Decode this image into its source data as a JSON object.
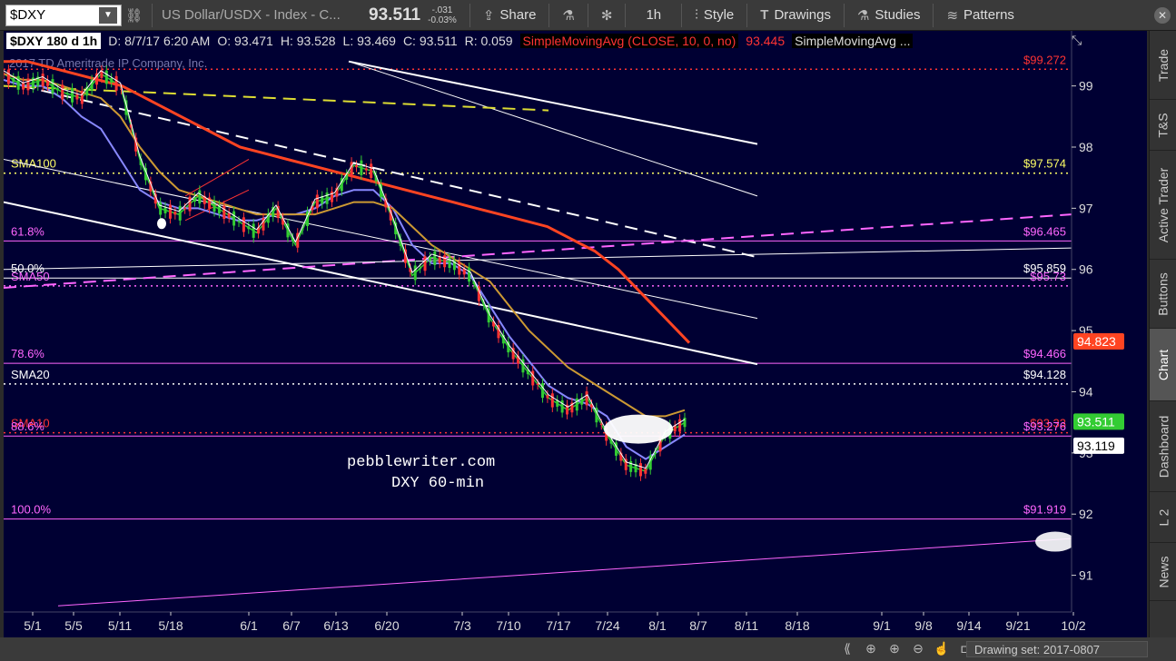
{
  "toolbar": {
    "symbol": "$DXY",
    "description": "US Dollar/USDX - Index - C...",
    "price": "93.511",
    "change_abs": "-.031",
    "change_pct": "-0.03%",
    "share_label": "Share",
    "interval_label": "1h",
    "style_label": "Style",
    "drawings_label": "Drawings",
    "studies_label": "Studies",
    "patterns_label": "Patterns"
  },
  "infobar": {
    "symbol": "$DXY 180 d 1h",
    "date": "D: 8/7/17 6:20 AM",
    "open": "O: 93.471",
    "high": "H: 93.528",
    "low": "L: 93.469",
    "close": "C: 93.511",
    "range": "R: 0.059",
    "sma10_label": "SimpleMovingAvg (CLOSE, 10, 0, no)",
    "sma10_value": "93.445",
    "sma_more": "SimpleMovingAvg ..."
  },
  "watermark": "2017 TD Ameritrade IP Company, Inc.",
  "annotation": {
    "line1": "pebblewriter.com",
    "line2": "DXY 60-min"
  },
  "level_labels": [
    {
      "name": "SMA100",
      "left": "SMA100",
      "right": "$97.574",
      "price": 97.574,
      "color": "#ffff66",
      "style": "dotted"
    },
    {
      "name": "fib-61",
      "left": "61.8%",
      "right": "$96.465",
      "price": 96.465,
      "color": "#ff66ff",
      "style": "solid"
    },
    {
      "name": "fib-50",
      "left": "50.0%",
      "right": "$95.859",
      "price": 95.859,
      "color": "#ffffff",
      "style": "solid"
    },
    {
      "name": "SMA50",
      "left": "SMA50",
      "right": "$95.73",
      "price": 95.73,
      "color": "#ff66ff",
      "style": "dotted"
    },
    {
      "name": "fib-78",
      "left": "78.6%",
      "right": "$94.466",
      "price": 94.466,
      "color": "#ff66ff",
      "style": "solid"
    },
    {
      "name": "SMA20",
      "left": "SMA20",
      "right": "$94.128",
      "price": 94.128,
      "color": "#ffffff",
      "style": "dotted"
    },
    {
      "name": "SMA10",
      "left": "SMA10",
      "right": "$93.33",
      "price": 93.33,
      "color": "#ff3333",
      "style": "dotted"
    },
    {
      "name": "fib-88",
      "left": "88.6%",
      "right": "$93.276",
      "price": 93.276,
      "color": "#ff66ff",
      "style": "solid"
    },
    {
      "name": "fib-100",
      "left": "100.0%",
      "right": "$91.919",
      "price": 91.919,
      "color": "#ff66ff",
      "style": "solid"
    },
    {
      "name": "top-level",
      "left": "",
      "right": "$99.272",
      "price": 99.272,
      "color": "#ff3333",
      "style": "dotted"
    }
  ],
  "price_badges": [
    {
      "name": "sma-badge",
      "value": "94.823",
      "price": 94.823,
      "bg": "#ff4422",
      "fg": "#ffffff"
    },
    {
      "name": "last-price-badge",
      "value": "93.511",
      "price": 93.511,
      "bg": "#33cc33",
      "fg": "#ffffff"
    },
    {
      "name": "price-badge-white",
      "value": "93.119",
      "price": 93.119,
      "bg": "#ffffff",
      "fg": "#000000"
    }
  ],
  "chart_data": {
    "type": "line",
    "title": "",
    "y_ticks": [
      91,
      92,
      93,
      94,
      95,
      96,
      97,
      98,
      99
    ],
    "ylim": [
      90.4,
      99.9
    ],
    "x_ticks": [
      "5/1",
      "5/5",
      "5/11",
      "5/18",
      "6/1",
      "6/7",
      "6/13",
      "6/20",
      "7/3",
      "7/10",
      "7/17",
      "7/24",
      "8/1",
      "8/7",
      "8/11",
      "8/18",
      "9/1",
      "9/8",
      "9/14",
      "9/21",
      "10/2"
    ],
    "grid": false,
    "series": [
      {
        "values": [
          99.2,
          99.0,
          99.1,
          98.9,
          98.8,
          99.2,
          99.0,
          97.8,
          97.0,
          96.9,
          97.2,
          97.0,
          96.8,
          96.6,
          97.0,
          96.4,
          97.1,
          97.2,
          97.7,
          97.6,
          96.8,
          95.9,
          96.2,
          96.1,
          95.9,
          95.2,
          94.7,
          94.3,
          93.9,
          93.7,
          93.9,
          93.3,
          92.8,
          92.7,
          93.3,
          93.5
        ],
        "color": "#33cc33"
      },
      {
        "values": [
          99.1,
          99.0,
          99.0,
          98.8,
          98.5,
          98.3,
          97.8,
          97.3,
          97.1,
          97.0,
          97.0,
          96.9,
          96.8,
          96.8,
          96.9,
          96.9,
          97.0,
          97.2,
          97.3,
          97.3,
          97.0,
          96.4,
          96.1,
          96.1,
          95.9,
          95.4,
          94.9,
          94.5,
          94.1,
          93.9,
          93.8,
          93.6,
          93.1,
          92.9,
          93.1,
          93.3
        ],
        "color": "#8888ff"
      },
      {
        "values": [
          99.2,
          99.1,
          99.1,
          99.0,
          98.9,
          98.8,
          98.5,
          98.0,
          97.6,
          97.3,
          97.2,
          97.1,
          97.0,
          96.9,
          96.9,
          96.9,
          96.9,
          97.0,
          97.1,
          97.1,
          97.0,
          96.7,
          96.4,
          96.2,
          96.0,
          95.8,
          95.4,
          95.0,
          94.7,
          94.4,
          94.2,
          94.0,
          93.8,
          93.6,
          93.6,
          93.7
        ],
        "color": "#cc9933"
      },
      {
        "values": [
          99.4,
          99.4,
          99.3,
          99.2,
          99.1,
          99.0,
          98.8,
          98.6,
          98.4,
          98.2,
          98.0,
          97.9,
          97.8,
          97.7,
          97.6,
          97.5,
          97.4,
          97.3,
          97.2,
          97.1,
          97.0,
          96.9,
          96.8,
          96.7,
          96.5,
          96.3,
          96.0,
          95.6,
          95.2,
          94.8
        ],
        "color": "#ff4422"
      }
    ]
  }
}
